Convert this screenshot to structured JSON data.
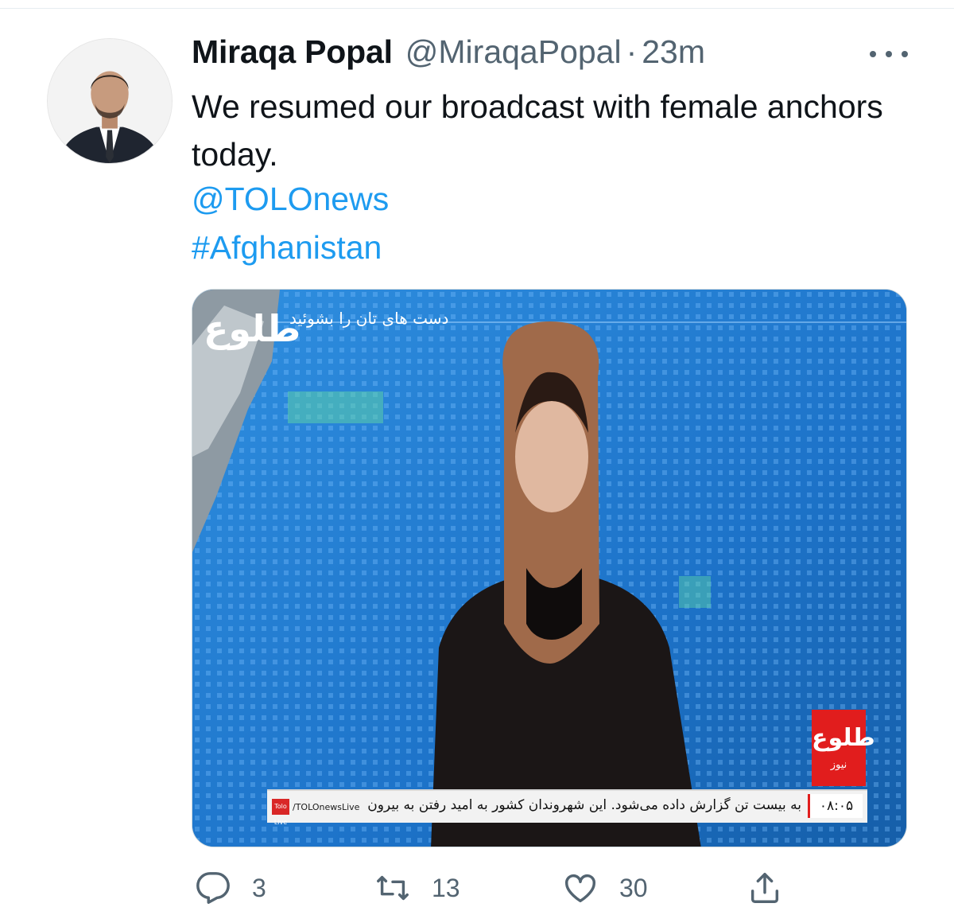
{
  "tweet": {
    "display_name": "Miraqa Popal",
    "handle": "@MiraqaPopal",
    "separator": "·",
    "timestamp": "23m",
    "text": "We resumed our broadcast with female anchors today.",
    "mention": "@TOLOnews",
    "hashtag": "#Afghanistan"
  },
  "media": {
    "logo_text": "طلوع",
    "promo_text": "دست های تان را بشوئید",
    "red_logo_text": "طلوع",
    "red_logo_sub": "نیوز",
    "ticker_badge": "Tolo Live",
    "ticker_source": "/TOLOnewsLive",
    "ticker_text": "به بیست تن گزارش داده می‌شود. این شهروندان کشور به امید رفتن به بیرون",
    "ticker_time": "۰۸:۰۵"
  },
  "actions": {
    "reply_count": "3",
    "retweet_count": "13",
    "like_count": "30"
  },
  "icons": {
    "more": "more-horizontal-icon",
    "reply": "reply-icon",
    "retweet": "retweet-icon",
    "like": "heart-icon",
    "share": "share-icon"
  },
  "colors": {
    "link": "#1d9bf0",
    "secondary_text": "#536471",
    "primary_text": "#0f1419"
  }
}
